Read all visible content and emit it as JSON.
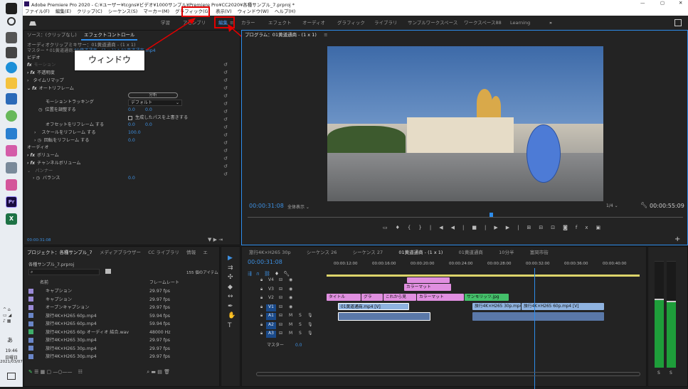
{
  "window_title": "Adobe Premiere Pro 2020 - C:¥ユーザー¥tcgns¥ビデオ¥1000サンプル¥Premiere Pro¥CC2020¥各種サンプル_7.prproj *",
  "menu": [
    "ファイル(F)",
    "編集(E)",
    "クリップ(C)",
    "シーケンス(S)",
    "マーカー(M)",
    "グラフィック(G)",
    "表示(V)",
    "ウィンドウ(W)",
    "ヘルプ(H)"
  ],
  "workspaces": [
    "学習",
    "アセンブリ",
    "編集",
    "カラー",
    "エフェクト",
    "オーディオ",
    "グラフィック",
    "ライブラリ",
    "サンプルワークスペース",
    "ワークスペース88",
    "Learning"
  ],
  "callouts": {
    "window": "ウィンドウ",
    "edit": "編集"
  },
  "effect_panel": {
    "tabs": [
      "ソース：(クリップなし)",
      "エフェクトコントロール",
      "オーディオクリップミキサー：01黄道通商 - (1 x 1)"
    ],
    "master": "マスター * 01黄道通商.mp4",
    "clip_path": "01黄道通商 - (1 x 1) * 01黄道通商.mp4",
    "video_label": "ビデオ",
    "motion": "モーション",
    "opacity": "不透明度",
    "time_remap": "タイムリマップ",
    "auto_reframe": "オートリフレーム",
    "analyze_btn": "分析",
    "motion_tracking": "モーショントラッキング",
    "motion_tracking_value": "デフォルト",
    "adjust_position": "位置を調整する",
    "pos_x": "0.0",
    "pos_y": "0.0",
    "generated_path": "生成したパスを上書きする",
    "offset_reframe": "オフセットをリフレーム する",
    "offset_x": "0.0",
    "offset_y": "0.0",
    "scale_reframe": "スケールをリフレーム する",
    "scale_value": "100.0",
    "rotation_reframe": "回転をリフレーム する",
    "rotation_value": "0.0",
    "audio_label": "オーディオ",
    "volume": "ボリューム",
    "channel_volume": "チャンネルボリューム",
    "panner": "パンナー",
    "balance": "バランス",
    "balance_value": "0.0",
    "timecode": "00:00:31:08"
  },
  "program": {
    "title": "プログラム：01黄道通商 - (1 x 1)",
    "timecode": "00:00:31:08",
    "fit": "全体表示",
    "ratio": "1/4",
    "duration": "00:00:55:09"
  },
  "project": {
    "tabs": [
      "プロジェクト：各種サンプル_7",
      "メディアブラウザー",
      "CC ライブラリ",
      "情報",
      "エ"
    ],
    "file": "各種サンプル_7.prproj",
    "item_count": "155 個のアイテム",
    "col_name": "名前",
    "col_rate": "フレームレート",
    "items": [
      {
        "name": "キャプション",
        "rate": "29.97 fps",
        "color": "#9a8ad6"
      },
      {
        "name": "キャプション",
        "rate": "29.97 fps",
        "color": "#9a8ad6"
      },
      {
        "name": "オープンキャプション",
        "rate": "29.97 fps",
        "color": "#9a8ad6"
      },
      {
        "name": "旅行4K×H265 60p.mp4",
        "rate": "59.94 fps",
        "color": "#6a86c8"
      },
      {
        "name": "旅行4K×H265 60p.mp4",
        "rate": "59.94 fps",
        "color": "#6a86c8"
      },
      {
        "name": "旅行4K×H265 60p オーディオ 結合.wav",
        "rate": "48000 Hz",
        "color": "#3fae6a"
      },
      {
        "name": "旅行4K×H265 30p.mp4",
        "rate": "29.97 fps",
        "color": "#6a86c8"
      },
      {
        "name": "旅行4K×H265 30p.mp4",
        "rate": "29.97 fps",
        "color": "#6a86c8"
      },
      {
        "name": "旅行4K×H265 30p.mp4",
        "rate": "29.97 fps",
        "color": "#6a86c8"
      }
    ]
  },
  "timeline": {
    "tabs": [
      "旅行4K×H265 30p",
      "シーケンス 26",
      "シーケンス 27",
      "01黄道通商 - (1 x 1)",
      "01黄道通商",
      "10分半",
      "富岡市街"
    ],
    "timecode": "00:00:31:08",
    "ruler": [
      "00:00:12:00",
      "00:00:16:00",
      "00:00:20:00",
      "00:00:24:00",
      "00:00:28:00",
      "00:00:32:00",
      "00:00:36:00",
      "00:00:40:00"
    ],
    "tracks": [
      "V4",
      "V3",
      "V2",
      "V1",
      "A1",
      "A2",
      "A3"
    ],
    "master_label": "マスター",
    "master_value": "0.0",
    "clips": {
      "v3": "カラーマット",
      "v2a": "タイトル",
      "v2b": "グラ",
      "v2c": "これから見",
      "v2d": "カラーマット",
      "v2e": "サンモリッツ.jpg",
      "v1a": "01黄道通商.mp4 [V]",
      "v1b": "旅行4K×H265 30p.mp4 [V]",
      "v1c": "旅行4K×H265 60p.mp4 [V]"
    }
  },
  "meter_labels": [
    "S",
    "S"
  ],
  "taskbar": {
    "time": "19:46",
    "day": "日曜日",
    "date": "2021/03/07",
    "ime": "あ"
  },
  "colors": {
    "accent": "#2d8ceb",
    "highlight": "#e10000",
    "clip_video": "#8fb3e0",
    "clip_graphic": "#e08fe0",
    "clip_image": "#44c06a"
  }
}
